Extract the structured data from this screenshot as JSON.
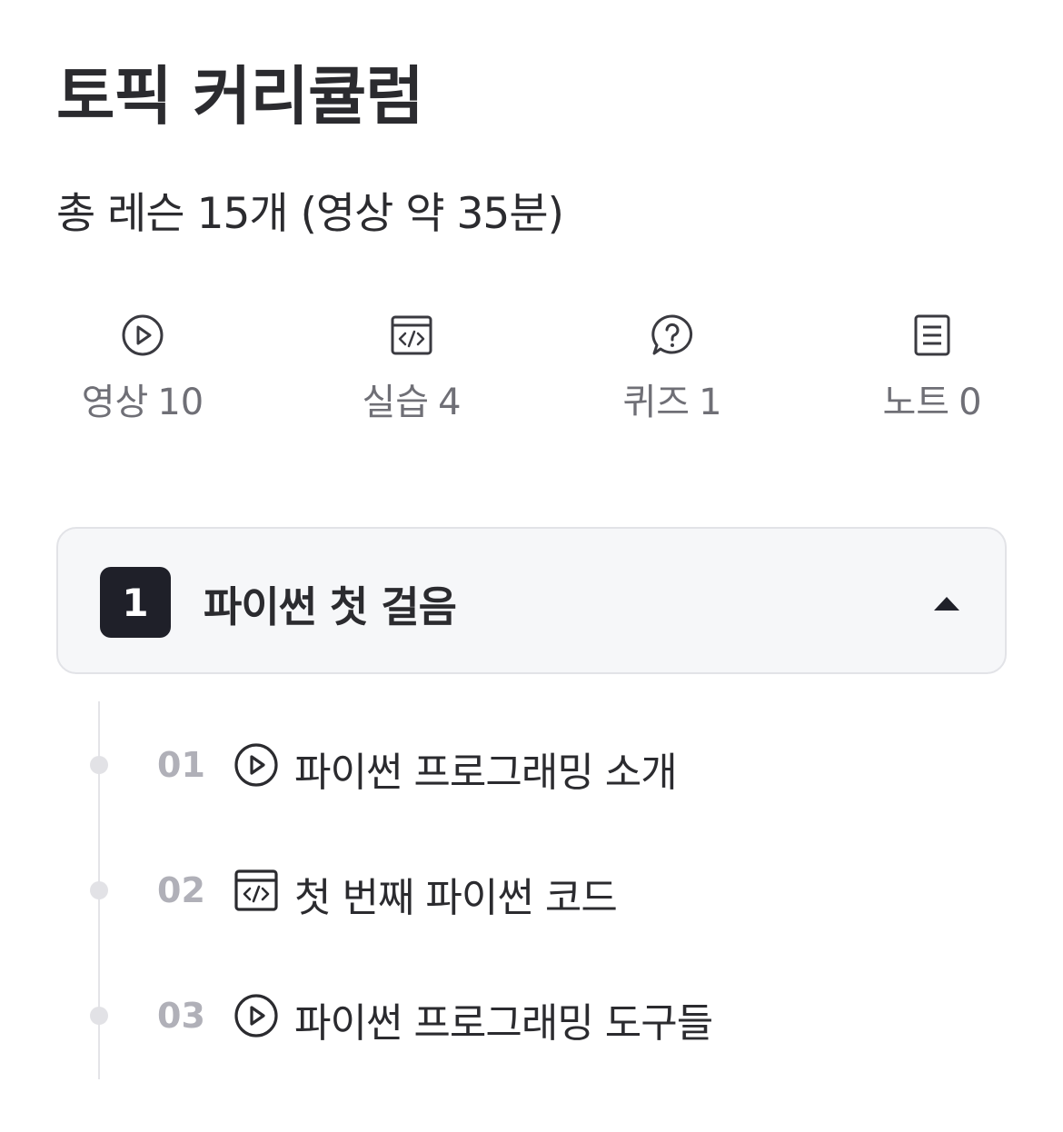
{
  "page": {
    "title": "토픽 커리큘럼",
    "summary": "총 레슨 15개 (영상 약 35분)"
  },
  "stats": [
    {
      "icon": "video-icon",
      "label": "영상",
      "count": "10"
    },
    {
      "icon": "code-icon",
      "label": "실습",
      "count": "4"
    },
    {
      "icon": "quiz-icon",
      "label": "퀴즈",
      "count": "1"
    },
    {
      "icon": "note-icon",
      "label": "노트",
      "count": "0"
    }
  ],
  "section": {
    "number": "1",
    "title": "파이썬 첫 걸음",
    "expanded": true
  },
  "lessons": [
    {
      "number": "01",
      "type": "video",
      "icon": "video-icon",
      "title": "파이썬 프로그래밍 소개"
    },
    {
      "number": "02",
      "type": "code",
      "icon": "code-icon",
      "title": "첫 번째 파이썬 코드"
    },
    {
      "number": "03",
      "type": "video",
      "icon": "video-icon",
      "title": "파이썬 프로그래밍 도구들"
    }
  ],
  "colors": {
    "text": "#2b2b2f",
    "muted": "#6f6f76",
    "lesson_number": "#b0b0b8",
    "badge_bg": "#1f2029",
    "card_bg": "#f6f7f9",
    "card_border": "#e2e3e7"
  }
}
